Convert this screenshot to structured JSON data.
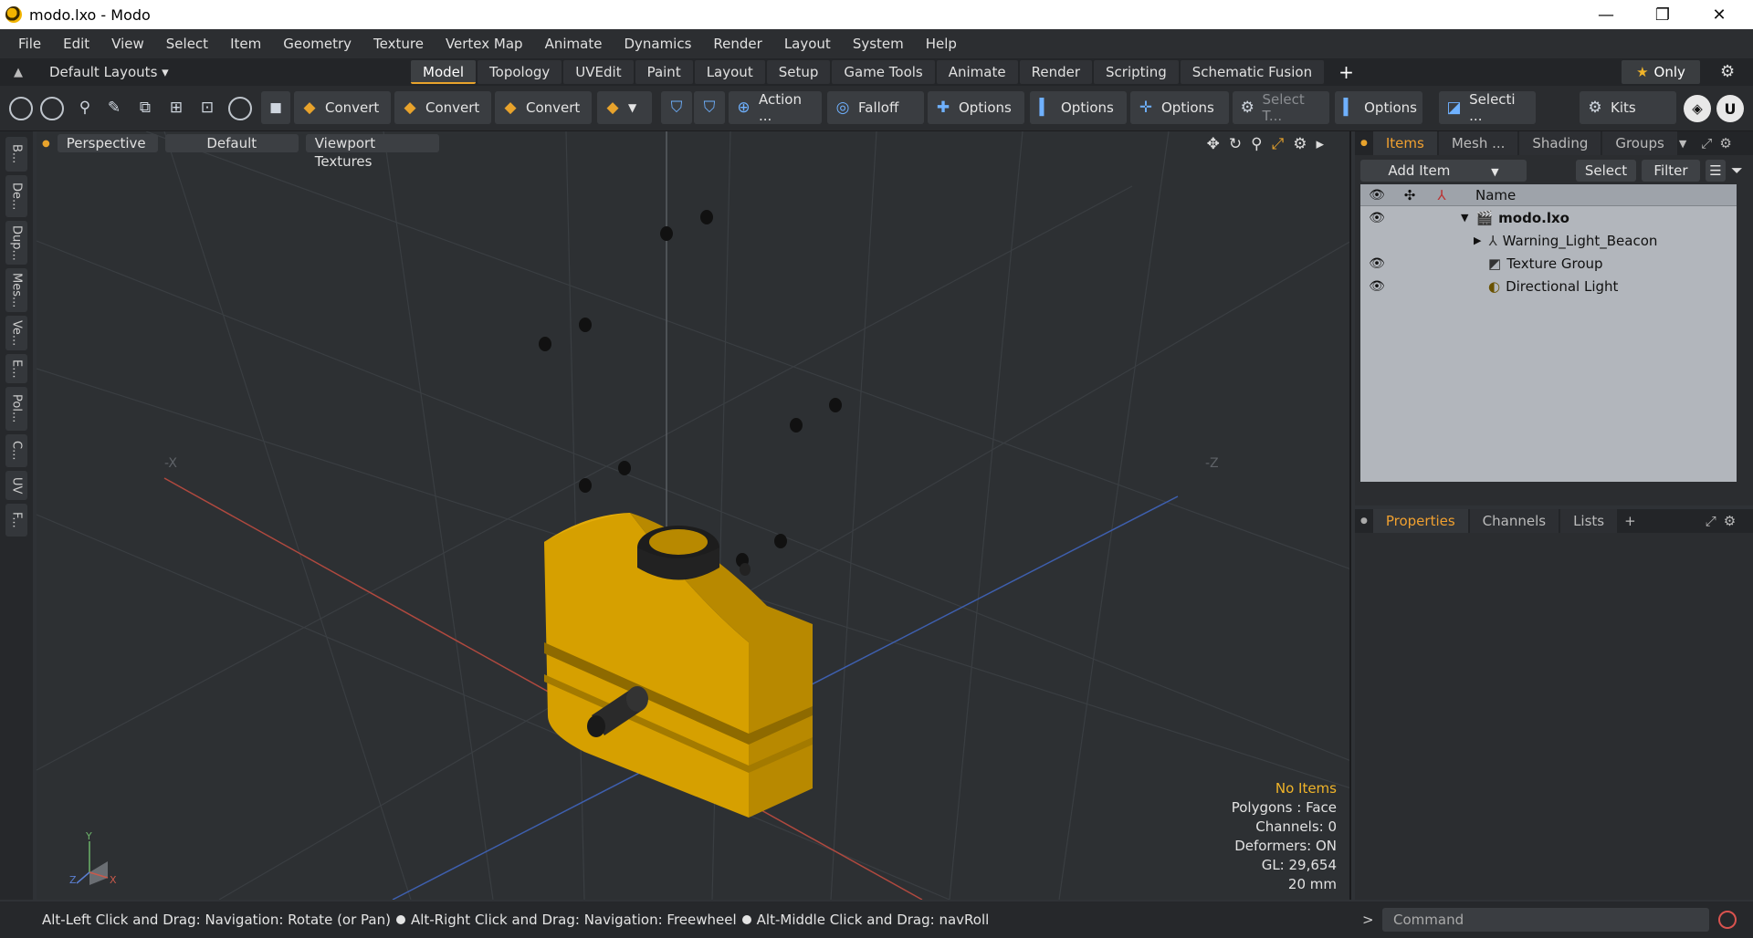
{
  "window": {
    "title": "modo.lxo - Modo",
    "minimize": "—",
    "restore": "❐",
    "close": "✕"
  },
  "menu": [
    "File",
    "Edit",
    "View",
    "Select",
    "Item",
    "Geometry",
    "Texture",
    "Vertex Map",
    "Animate",
    "Dynamics",
    "Render",
    "Layout",
    "System",
    "Help"
  ],
  "layouts": {
    "dropdown": "Default Layouts ▾",
    "tabs": [
      "Model",
      "Topology",
      "UVEdit",
      "Paint",
      "Layout",
      "Setup",
      "Game Tools",
      "Animate",
      "Render",
      "Scripting",
      "Schematic Fusion"
    ],
    "active": "Model",
    "only_label": "Only"
  },
  "toolbar": {
    "convert1": "Convert",
    "convert2": "Convert",
    "convert3": "Convert",
    "action": "Action ...",
    "falloff": "Falloff",
    "options1": "Options",
    "options2": "Options",
    "options3": "Options",
    "options4": "Options",
    "select_t": "Select T...",
    "selecti": "Selecti ...",
    "kits": "Kits"
  },
  "leftstrip": [
    "B...",
    "De...",
    "Dup...",
    "Mes...",
    "Ve...",
    "E...",
    "Pol...",
    "C...",
    "UV",
    "F..."
  ],
  "viewport": {
    "view": "Perspective",
    "shading": "Default",
    "textures": "Viewport Textures",
    "axis_neg_x": "-X",
    "axis_neg_z": "-Z",
    "stats": {
      "selection": "No Items",
      "polygons": "Polygons : Face",
      "channels": "Channels: 0",
      "deformers": "Deformers: ON",
      "gl": "GL: 29,654",
      "unit": "20 mm"
    }
  },
  "items_panel": {
    "tabs": [
      "Items",
      "Mesh ...",
      "Shading",
      "Groups"
    ],
    "add_item": "Add Item",
    "select": "Select",
    "filter": "Filter",
    "col_name": "Name",
    "rows": [
      "modo.lxo",
      "Warning_Light_Beacon",
      "Texture Group",
      "Directional Light"
    ]
  },
  "properties_panel": {
    "tabs": [
      "Properties",
      "Channels",
      "Lists"
    ]
  },
  "status": {
    "hint1": "Alt-Left Click and Drag: Navigation: Rotate (or Pan)",
    "hint2": "Alt-Right Click and Drag: Navigation: Freewheel",
    "hint3": "Alt-Middle Click and Drag: navRoll"
  },
  "command": {
    "placeholder": "Command"
  },
  "colors": {
    "accent": "#e8a32c",
    "model_yellow": "#d9a200",
    "selection_text": "#f0b429"
  }
}
